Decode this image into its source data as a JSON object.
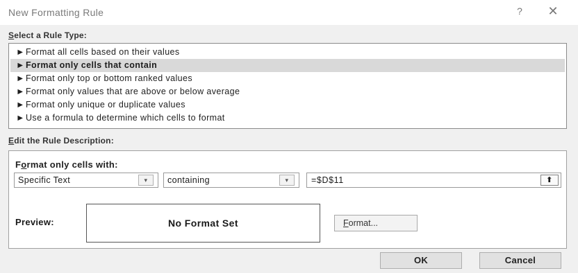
{
  "dialog": {
    "title": "New Formatting Rule",
    "help_label": "?",
    "close_label": "✕"
  },
  "rule_type": {
    "label_first": "S",
    "label_rest": "elect a Rule Type:",
    "items": [
      {
        "arrow": "►",
        "label": "Format all cells based on their values"
      },
      {
        "arrow": "►",
        "label": "Format only cells that contain"
      },
      {
        "arrow": "►",
        "label": "Format only top or bottom ranked values"
      },
      {
        "arrow": "►",
        "label": "Format only values that are above or below average"
      },
      {
        "arrow": "►",
        "label": "Format only unique or duplicate values"
      },
      {
        "arrow": "►",
        "label": "Use a formula to determine which cells to format"
      }
    ],
    "selected_index": 1
  },
  "description": {
    "label_first": "E",
    "label_rest": "dit the Rule Description:",
    "format_only_label_first": "F",
    "format_only_label_u": "o",
    "format_only_label_rest": "rmat only cells with:",
    "condition_type": "Specific Text",
    "operator": "containing",
    "value": "=$D$11",
    "dropdown_glyph": "▾",
    "collapse_glyph": "⬆",
    "preview_label": "Preview:",
    "preview_text": "No Format Set",
    "format_button_first": "F",
    "format_button_rest": "ormat..."
  },
  "buttons": {
    "ok": "OK",
    "cancel": "Cancel"
  }
}
